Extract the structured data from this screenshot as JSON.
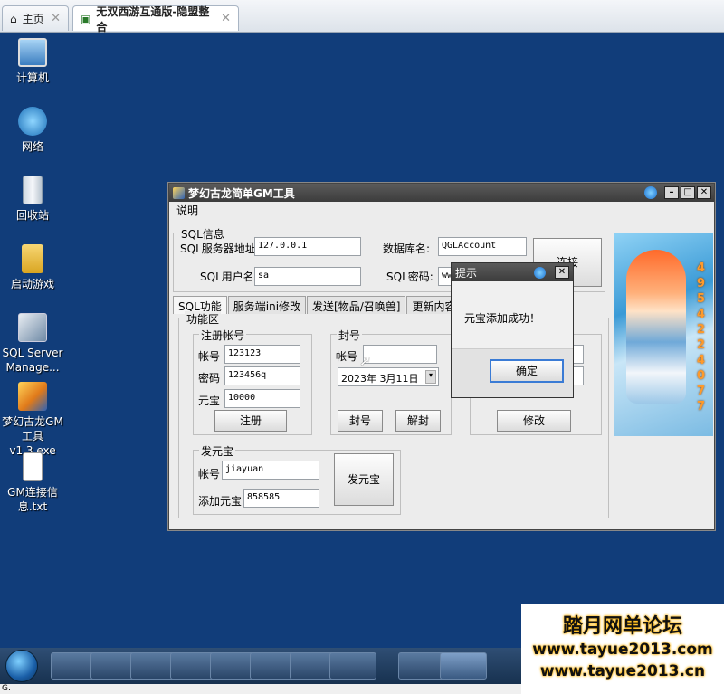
{
  "browser": {
    "tabs": [
      {
        "label": "主页",
        "active": false
      },
      {
        "label": "无双西游互通版-隐盟整合",
        "active": true
      }
    ]
  },
  "desktop_icons": [
    {
      "label": "计算机",
      "icon": "computer-icon"
    },
    {
      "label": "网络",
      "icon": "network-icon"
    },
    {
      "label": "回收站",
      "icon": "recycle-bin-icon"
    },
    {
      "label": "启动游戏",
      "icon": "folder-icon"
    },
    {
      "label": "SQL Server Manage...",
      "icon": "sql-server-icon"
    },
    {
      "label": "梦幻古龙GM工具v1.3.exe",
      "icon": "gm-tool-icon"
    },
    {
      "label": "GM连接信息.txt",
      "icon": "text-file-icon"
    }
  ],
  "window": {
    "title": "梦幻古龙简单GM工具",
    "menu": "说明",
    "sql": {
      "legend": "SQL信息",
      "server_label": "SQL服务器地址:",
      "server_value": "127.0.0.1",
      "db_label": "数据库名:",
      "db_value": "QGLAccount",
      "user_label": "SQL用户名:",
      "user_value": "sa",
      "pwd_label": "SQL密码:",
      "pwd_value": "www",
      "connect_label": "连接"
    },
    "tabs": [
      "SQL功能",
      "服务端ini修改",
      "发送[物品/召唤兽]",
      "更新内容说明"
    ],
    "func_legend": "功能区",
    "register": {
      "legend": "注册帐号",
      "account_label": "帐号",
      "account_value": "123123",
      "password_label": "密码",
      "password_value": "123456q",
      "yuanbao_label": "元宝",
      "yuanbao_value": "10000",
      "button": "注册"
    },
    "ban": {
      "legend": "封号",
      "account_label": "帐号",
      "account_value": "",
      "date_value": "2023年 3月11日",
      "ban_button": "封号",
      "unban_button": "解封"
    },
    "modify_button": "修改",
    "send": {
      "legend": "发元宝",
      "account_label": "帐号",
      "account_value": "jiayuan",
      "amount_label": "添加元宝",
      "amount_value": "858585",
      "button": "发元宝"
    },
    "ad_text": "4954224077"
  },
  "dialog": {
    "title": "提示",
    "message": "元宝添加成功！",
    "ok": "确定"
  },
  "status_text": "G.",
  "watermark": {
    "title": "踏月网单论坛",
    "url1": "www.tayue2013.com",
    "url2": "www.tayue2013.cn"
  }
}
